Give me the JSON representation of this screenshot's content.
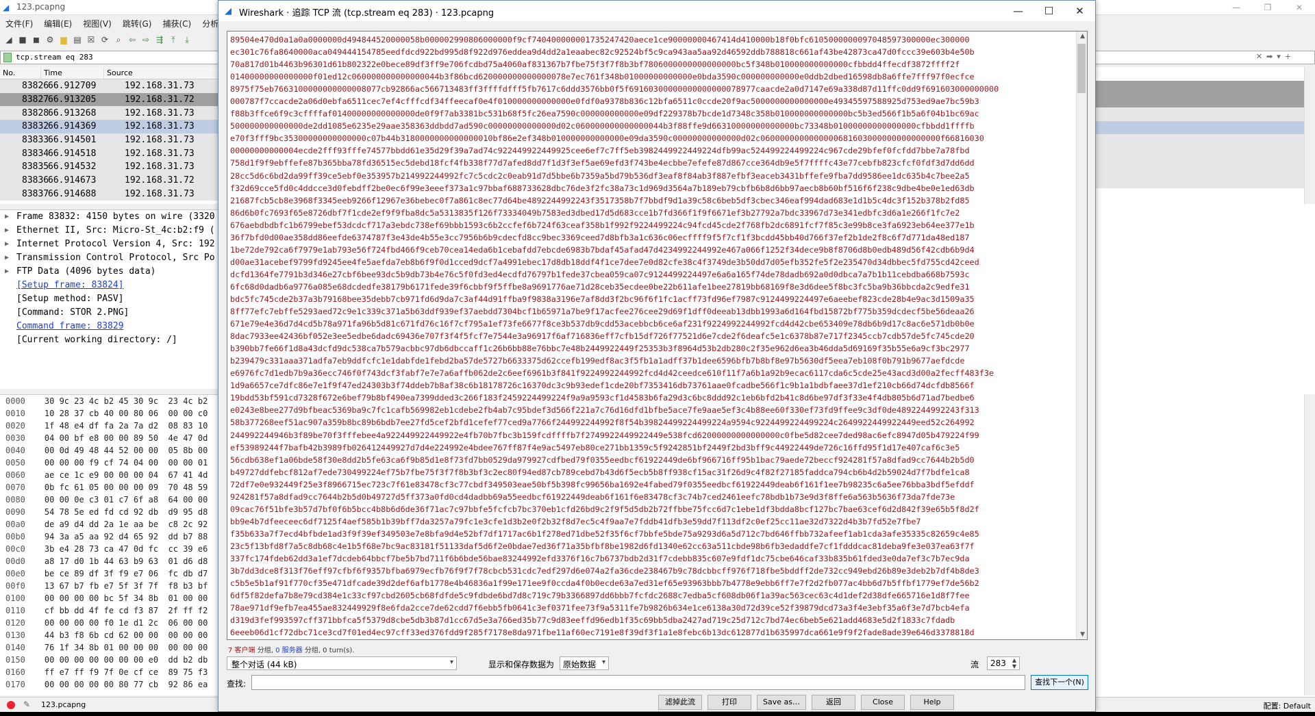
{
  "main": {
    "title": "123.pcapng",
    "window_controls": [
      "—",
      "❐",
      "✕"
    ],
    "menu": [
      "文件(F)",
      "编辑(E)",
      "视图(V)",
      "跳转(G)",
      "捕获(C)",
      "分析("
    ],
    "filter": {
      "value": "tcp.stream eq 283",
      "right_controls": [
        "✕",
        "➡",
        "▾",
        "+"
      ]
    },
    "packet_list": {
      "headers": [
        "No.",
        "Time",
        "Source"
      ],
      "rows": [
        {
          "no": "83826",
          "time": "66.912709",
          "source": "192.168.31.73"
        },
        {
          "no": "83827",
          "time": "66.913205",
          "source": "192.168.31.72"
        },
        {
          "no": "83828",
          "time": "66.913268",
          "source": "192.168.31.73"
        },
        {
          "no": "83832",
          "time": "66.914369",
          "source": "192.168.31.73"
        },
        {
          "no": "83833",
          "time": "66.914501",
          "source": "192.168.31.73"
        },
        {
          "no": "83834",
          "time": "66.914518",
          "source": "192.168.31.73"
        },
        {
          "no": "83835",
          "time": "66.914532",
          "source": "192.168.31.73"
        },
        {
          "no": "83836",
          "time": "66.914673",
          "source": "192.168.31.72"
        },
        {
          "no": "83837",
          "time": "66.914688",
          "source": "192.168.31.73"
        }
      ]
    },
    "details": [
      {
        "text": "Frame 83832: 4150 bytes on wire (3320",
        "expandable": true
      },
      {
        "text": "Ethernet II, Src: Micro-St_4c:b2:f9 (",
        "expandable": true
      },
      {
        "text": "Internet Protocol Version 4, Src: 192",
        "expandable": true
      },
      {
        "text": "Transmission Control Protocol, Src Po",
        "expandable": true
      },
      {
        "text": "FTP Data (4096 bytes data)",
        "expandable": true
      },
      {
        "text": "[Setup frame: 83824]",
        "link": true
      },
      {
        "text": "[Setup method: PASV]"
      },
      {
        "text": "[Command: STOR 2.PNG]"
      },
      {
        "text": "Command frame: 83829",
        "link": true
      },
      {
        "text": "[Current working directory: /]"
      }
    ],
    "bytes": [
      {
        "off": "0000",
        "hex": "30 9c 23 4c b2 45 30 9c  23 4c b2"
      },
      {
        "off": "0010",
        "hex": "10 28 37 cb 40 00 80 06  00 00 c0"
      },
      {
        "off": "0020",
        "hex": "1f 48 e4 df fa 2a 7a d2  08 83 10"
      },
      {
        "off": "0030",
        "hex": "04 00 bf e8 00 00 89 50  4e 47 0d"
      },
      {
        "off": "0040",
        "hex": "00 0d 49 48 44 52 00 00  05 8b 00"
      },
      {
        "off": "0050",
        "hex": "00 00 00 f9 cf 74 04 00  00 00 01"
      },
      {
        "off": "0060",
        "hex": "ae ce 1c e9 00 00 00 04  67 41 4d"
      },
      {
        "off": "0070",
        "hex": "0b fc 61 05 00 00 00 09  70 48 59"
      },
      {
        "off": "0080",
        "hex": "00 00 0e c3 01 c7 6f a8  64 00 00"
      },
      {
        "off": "0090",
        "hex": "54 78 5e ed fd cd 92 db  d9 95 d8"
      },
      {
        "off": "00a0",
        "hex": "de a9 d4 dd 2a 1e aa be  c8 2c 92"
      },
      {
        "off": "00b0",
        "hex": "94 3a a5 aa 92 d4 65 92  dd b7 88"
      },
      {
        "off": "00c0",
        "hex": "3b e4 28 73 ca 47 0d fc  cc 39 e6"
      },
      {
        "off": "00d0",
        "hex": "a8 17 d0 1b 44 63 b9 63  01 d6 d8"
      },
      {
        "off": "00e0",
        "hex": "be ce 89 df 3f f9 e7 06  fc db d7"
      },
      {
        "off": "00f0",
        "hex": "13 67 b7 fb e7 5f 3f 7f  f8 b3 bf"
      },
      {
        "off": "0100",
        "hex": "00 00 00 00 bc 5f 34 8b  01 00 00"
      },
      {
        "off": "0110",
        "hex": "cf bb dd 4f fe cd f3 87  2f ff f2"
      },
      {
        "off": "0120",
        "hex": "00 00 00 00 f0 1e d1 2c  06 00 00"
      },
      {
        "off": "0130",
        "hex": "44 b3 f8 6b cd 62 00 00  00 00 00"
      },
      {
        "off": "0140",
        "hex": "76 1f 34 8b 01 00 00 00  00 00 00"
      },
      {
        "off": "0150",
        "hex": "00 00 00 00 00 00 00 e0  dd b2 db"
      },
      {
        "off": "0160",
        "hex": "ff e7 ff f9 7f 0e cf ce  89 75 f3"
      },
      {
        "off": "0170",
        "hex": "00 00 00 00 00 80 77 cb  92 86 ea"
      }
    ],
    "status": {
      "file": "123.pcapng",
      "profile": "配置: Default"
    }
  },
  "dialog": {
    "title": "Wireshark · 追踪 TCP 流 (tcp.stream eq 283) · 123.pcapng",
    "window_controls": [
      "—",
      "☐",
      "✕"
    ],
    "stream_lines": [
      "89504e470d0a1a0a0000000d494844520000058b000002990806000000f9cf740400000001735247420aece1ce90000000467414d410000b18f0bfc6105000000097048597300000ec300000",
      "ec301c76fa8640000aca049444154785eedfdcd922bd995d8f922d976eddea9d4dd2a1eaabec82c92524bf5c9ca943aa5aa92d46592ddb788818c661af43be42873ca47d0fccc39e603b4e50b",
      "70a817d01b4463b96301d61b802322e0bece89df3ff9e706fcdbd75a4060af831367b7fbe75f3f7f8b3bf7806000000000000000bc5f348b010000000000000cfbbdd4ffecdf3872ffff2f",
      "01400000000000000f01ed12c060000000000000044b3f86bcd620000000000000078e7ec761f348b01000000000000e0bda3590c000000000000e0ddb2dbed16598db8a6ffe7fff97f0ecfce",
      "8975f75eb7663100000000000008077cb92866ac566713483ff3ffffdfff5fb7617c6ddd3576bb0f5f69160300000000000000078977caacde2a0d7147e69a338d87d11ffc0dd9f691603000000000",
      "000787f7ccacde2a06d0ebfa6511cec7ef4cfffcdf34ffeecaf0e4f010000000000000e0fdf0a9378b836c12bfa6511c0ccde20f9ac5000000000000000e49345597588925d753ed9ae7bc59b3",
      "f88b3ffce6f9c3cffffaf01400000000000000de0f9f7ab3381bc531b68f5fc26ea7590c000000000000e09df229378b7bcde1d7348c358b010000000000000bc5b3ed566f1b5a6f04b1bc69ac",
      "500000000000000de2dd1085e6235e29aae358363ddbdd7ad590c00000000000000d02c060000000000000044b3f88ffe9d66310000000000000bc73348b01000000000000000cfbbdd1ffffb",
      "e70f3fff9bc35300000000000000c07b44b3180000000000000010bf86e2ef348b010000000000000e09da3590c00000000000000d02c0600000000000000681603000000000000000f66816030",
      "00000000000004ecde2fff93fffe74577bbdd61e35d29f39a7ad74c922449922449925cee6ef7c7ff5eb3982449922449224dfb99ac524499224499224c967cde29bfef0fcfdd7bbe7a78fbd",
      "758d1f9f9ebffefe87b365bba78fd36515ec5debd18fcf4fb338f77d7afed8dd7f1d3f3ef5ae69efd3f743be4ecbbe7efefe87d867cce364db9e5f7ffffc43e77cebfb823cfcf0fdf3d7dd6dd",
      "28cc5d6c6bd2da99ff39ce5ebf0e353957b214992244992fc7c5cdc2c0eab91d7d5bbe6b7359a5bd79b536df3eaf8f84ab3f887efbf3eaceb3431bffefe9fba7dd9586ee1dc635b4c7bee2a5",
      "f32d69cce5fd0c4ddcce3d0febdff2be0ec6f99e3eeef373a1c97bbaf688733628dbc76de3f2fc38a73c1d969d3564a7b189eb79cbfb6b8d6bb97aecb8b60bf516f6f238c9dbe4be0e1ed63db",
      "21687fcb5cb8e3968f3345eeb9266f12967e36bebec0f7a861c8ec77d64be4892244992243f3517358b7f7bbdf9d1a39c58c6beb5df3cbec346eaf994dad683e1d1b5c4dc3f152b378b2fd85",
      "86d6b0fc7693f65e8726dbf7f1cde2ef9f9fba8dc5a5313835f126f73334049b7583ed3dbed17d5d683cce1b7fd366f1f9f6671ef3b27792a7bdc33967d73e341edbfc3d6a1e266f1fc7e2",
      "676aebdbdbfc1b6799ebef53dcdcf717a3ebdc738ef69bbb1593c6b2ccfef6b724f63ceaf358b1f992f9224499224c94fcd45cde2f768fb2dc6891fcf7f85c3e99b8ce3fa6923eb64ee377e1b",
      "36f7bfd0d00ae358dd86eefde6374787f3e43de4b55e3cc7956b6b9cdecfd8cc9bec3369ceed7d8bfb3a1c636c06ecffff9f5f7cf1f3bcdd45bb40d766f37ef2b1de2f8c6f7d771da48ed187",
      "1be72de792ca6f7979e1ab793e56f724fbd466f9ceb70cea14eda6b1cebafdd7ebcde6983b7bdaf45afad47d4234992244992e467a066f1252f34dece9b8f8706d8b0edb489d56f42cdb6b9d4",
      "d00ae31acebef9799fd9245ee4fe5aefda7eb8b6f9f0d1cced9dcf7a4991ebec17d8db18ddf4f1ce7dee7e0d82cfe38c4f3749de3b50dd7d05efb352fe5f2e235470d34dbbec5fd755cd42ceed",
      "dcfd1364fe7791b3d346e27cbf6bee93dc5b9db73b4e76c5f0fd3ed4ecdfd76797b1fede37cbea059ca07c9124499224497e6a6a165f74de78dadb692a0d0dbca7a7b1b11cebdba668b7593c",
      "6fc68d0dadb6a9776a085e68dcdedfe38179b6171fede39f6cbbf9f5ffbe8a9691776ae71d28ceb35ecdee0be22b611afe1bee27819bb68169f8e3d6dee5f8bc3fc5ba9b36bbcda2c9edfe31",
      "bdc5fc745cde2b37a3b79168bee35debb7cb971fd6d9da7c3af44d91ffba9f9838a3196e7af8dd3f2bc96f6f1fc1acff73fd96ef7987c9124499224497e6aeebef823cde28b4e9ac3d1509a35",
      "8ff77efc7ebffe5293aed72c9e1c339c371a5b63ddf939ef37aebdd7304bcf1b65971a7be9f17acfee276cee29d69f1dff0deeab13dbb1993a6d164fbd15872bf775b359dcdecf5be56deaa26",
      "671e79e4e36d7d4cd5b78a971fa96b5d81c671fd76c16f7cf795a1ef73fe6677f8ce3b537db9cdd53acebbcb6ce6af231f9224992244992fcd4d42cbe653409e78db6b9d17c8ac6e571db0b0e",
      "8dac7933ee42436bf052e3ee5edbe6dadc69436e707f3f4f5fcf7e7544e3a96917f6af716836eff7cfb15df726f77521d6e7cde2f6deafc5e1c6378b87e717f2345ccb7cdb57de5fc745cde20",
      "b390bb7fe66f1d8a43dcfd9dc538ca7b579acbbc97db6dbccaff1c26b6bb88e76bbc7e48b2449922449f25353b3f8964d53b2db280c2f35e962d6ea3b46dda5d69169f35b55e6a9cf3bc2977",
      "b239479c331aaa371adfa7eb9ddfcfc1e1dabfde1febd2ba57de5727b6633375d62ccefb199edf8ac3f5fb1a1adff37b1dee6596bfb7b8bf8e97b5630df5eea7eb108f0b791b9677aefdcde",
      "e6976fc7d1edb7b9a36ecc746f0f743dcf3fabf7e7e7a6affb062de2c6eef6961b3f841f9224992244992fcd4d42ceedce610f11f7a6b1a92b9ecac6117cda6c5cde25e43acd3d00a2fecff483f3e",
      "1d9a6657ce7dfc86e7e1f9f47ed24303b3f74ddeb7b8af38c6b18178726c16370dc3c9b93edef1cde20bf7353416db73761aae0fcadbe566f1c9b1a1bdbfaee37d1ef210cb66d74dcfdb8566f",
      "19bdd53bf591cd7328f672e6bef79b8bf490ea7399dded3c266f183f2459224499224f9a9a9593cf1d4583b6fa29d3c6bc8ddd92c1eb6bfd2b41c8d6be97df3f33e4f4db805b6d71ad7bedbe6",
      "e0243e8bee277d9bfbeac5369ba9c7fc1cafb569982eb1cdebe2fb4ab7c95bdef3d566f221a7c76d16dfd1bfbe5ace7fe9aae5ef3c4b88ee60f330ef73fd9ffee9c3df0de4892244992243f313",
      "58b377268eef51ac907a359b8bc89b6bdb7ee27fd5cef2bfd1cefef77ced9a7766f244992244992f8f54b39824499224499224a9594c9224499224499224c2649922449922449eed52c264992",
      "244992244946b3f89be70f3fffebee4a922449922449922e4fb70b7fbc3b159fcdffffb7f2749922449922449e538fcd62000000000000000c0fbe5d82cee7ded98ac6efc8947d05b479224f99",
      "ef53989244f7bafb42b3989fb026412449927d7d4e224992e4bdee767ff87f4e9ac5497eb80ce271bb1359c5f9242851bf2449f2bd3bff9c44922449de726c16ffd95f1d17e407caf6c3e5",
      "56cdb638ef1a06bde58f30e8dd2b5fe63ca6f9b85d1e8f73fd7bb0529da979927cdfbed79f0355eedbcf61922449de6bf966716ff95b1bac79aede72beccf924281f57a8dfad9cc7644b2b5d0",
      "b49727ddfebcf812af7ede730499224ef75b7fbe75f3f7f8b3bf3c2ec80f94ed87cb789cebd7b43d6f5ecb5b8ff938cf15ac31f26d9c4f82f27185faddca794cb6b4d2b59024d7f7bdfe1ca8",
      "72df7e0e932449f25e3f8966715ec723c7f61e83478cf3c77cbdf349503eae50bf5b398fc99656ba1692e4fabed79f0355eedbcf61922449deab6f161f1ee7b98235c6a5ee76bba3bdf5efddf",
      "924281f57a8dfad9cc7644b2b5d0b49727d5ff373a0fd0cd4dadbb69a55eedbcf61922449deab6f161f6e83478cf3c74b7ced2461eefc78bdb1b73e9d3f8ffe6a563b5636f73da7fde73e",
      "09cac76f51bfe3b57d7bf0f6b5bcc4b8b6d6de36f71ac7c97bbfe5fcfcb7bc370eb1cfd26bd9c2f9f5d5db2b72ffbbe75fcc6d7c1ebe1df3bdda8bcf127bc7bae63cef6d2d842f39e65b5f8d2f",
      "bb9e4b7dfeeceec6df7125f4aef585b1b39bff7da3257a79fc1e3cfe1d3b2e0f2b32f8d7ec5c4f9aa7e7fddb41dfb3e59dd7f113df2c0ef25cc11ae32d7322d4b3b7fd52e7fbe7",
      "f35b633a7f7ecd4bfbde1ad3f9f39ef349503e7e8bfa9d4e52bf7df1717ac6b1f278ed71dbe52f35f6cf7bbfe5bde75a9293d6a5d712c7bd646ffbb732afeef1ab1cda3afe35335c82659c4e85",
      "23c5f13bfd8f7a5c8db68c4e1b5f68e7bc9ac83181f51133daf5d6f2e0bdae7ed36f71a35bfbf8be1982d6fd1340e62cc63a511cbde98b6fb3edaddfe7cf1fdddcac81deba9fe3e037ea63f7f",
      "337fc174fdeb62dd3a1ef7dcdeb64bbcf7be5b7bd711f6b6bde56bae83244992efd3376f16c7b6737bdb2d31f7cdebb835c607e9fdf1dc75cbe646caf33b835b61fded3e0da7ef3c7b7ec9da",
      "3b7dd3dce8f313f76eff97cfbf6f9357bfba6979ecfb76f9f7f78cbcb531cdc7edf297d6e074a2fa36cde238467b9c78dcbbcff976f718fbe5bddff2de732cc949ebd26b89e3deb2b7df4b8de3",
      "c5b5e5b1af91f770cf35e471dfcade39d2def6afb1778e4b46836a1f99e171ee9f0ccda4f0b0ecde63a7ed31ef65e93963bbb7b4778e9ebb6ff7e7f2d2fb077ac4bb6d7b5ffbf1779ef7de56b2",
      "6df5f82defa7b8e79cd384e1c33cf97cbd2605cb68fdfde5c9fdbde6bd7d8c719c79b3366897dd6bbb7fcfdc2688c7edba5cf608db06f1a39ac563cec63c4d1def2d38dfe665716e1d8f7fee",
      "78ae971df9efb7ea455ae832449929f8e6fda2cce7de62cdd7f6ebb5fb0641c3ef0371fee73f9a5311fe7b9826b634e1ce6138a30d72d39ce52f39879dcd73a3f4e3ebf35a6f3e7d7bcb4efa",
      "d319d3fef993597cff371bbfca5f5379d8cbe5db3b87d1cc67d5e3a766ed35b77c9d83eeffd96edb1f35c69bb5dba2427ad719c25d712c7bd74ec6beb5e621add4683e5d2f1833c7fdadb",
      "6eeeb06d1cf72dbc71ce3cd7f01ed4ec97cff33ed376fdd9f285f7178e8da971fbe11af60ec7191e8f39df3f1a1e8febc6b13dc612877d1b635997dca661e9f9f2fade8ade39e646d3378818d"
    ],
    "stats": {
      "client": "7 客户端",
      "client_unit": " 分组, ",
      "server": "0 服务器",
      "server_unit": " 分组, 0 turn(s)."
    },
    "conversation": "整个对话 (44 kB)",
    "format_label": "显示和保存数据为",
    "format": "原始数据",
    "stream_label": "流",
    "stream_number": "283",
    "find_label": "查找:",
    "find_value": "",
    "find_next": "查找下一个(N)",
    "buttons": {
      "filter_out": "滤掉此流",
      "print": "打印",
      "save_as": "Save as…",
      "back": "返回",
      "close": "Close",
      "help": "Help"
    }
  }
}
